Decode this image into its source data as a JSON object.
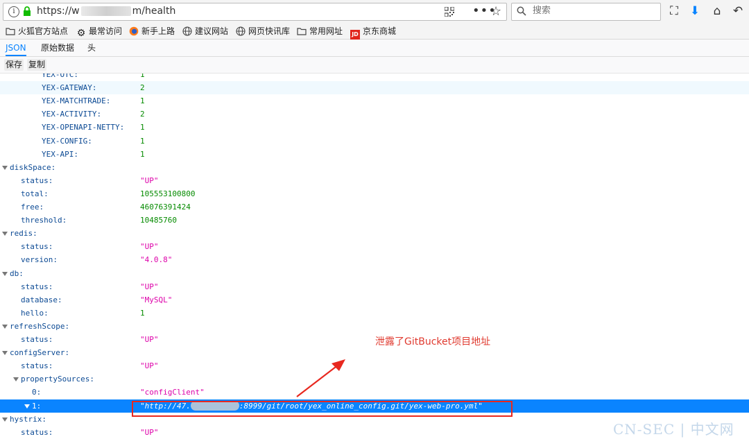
{
  "browser": {
    "url_prefix": "https://w",
    "url_suffix": "m/health",
    "search_placeholder": "搜索"
  },
  "bookmarks": [
    {
      "label": "火狐官方站点",
      "icon": "folder-icon"
    },
    {
      "label": "最常访问",
      "icon": "gear-icon"
    },
    {
      "label": "新手上路",
      "icon": "firefox-icon"
    },
    {
      "label": "建议网站",
      "icon": "globe-icon"
    },
    {
      "label": "网页快讯库",
      "icon": "globe-icon"
    },
    {
      "label": "常用网址",
      "icon": "folder-icon"
    },
    {
      "label": "京东商城",
      "icon": "jd-icon",
      "badge": "JD"
    }
  ],
  "viewer": {
    "tabs": [
      "JSON",
      "原始数据",
      "头"
    ],
    "buttons": [
      "保存",
      "复制"
    ]
  },
  "rows": [
    {
      "key": "YEX-OTC:",
      "val": "1",
      "type": "num",
      "indent": 60
    },
    {
      "key": "YEX-GATEWAY:",
      "val": "2",
      "type": "num",
      "indent": 60,
      "hl": true
    },
    {
      "key": "YEX-MATCHTRADE:",
      "val": "1",
      "type": "num",
      "indent": 60
    },
    {
      "key": "YEX-ACTIVITY:",
      "val": "2",
      "type": "num",
      "indent": 60
    },
    {
      "key": "YEX-OPENAPI-NETTY:",
      "val": "1",
      "type": "num",
      "indent": 60
    },
    {
      "key": "YEX-CONFIG:",
      "val": "1",
      "type": "num",
      "indent": 60
    },
    {
      "key": "YEX-API:",
      "val": "1",
      "type": "num",
      "indent": 60
    },
    {
      "key": "diskSpace:",
      "val": "",
      "type": "obj",
      "indent": 14
    },
    {
      "key": "status:",
      "val": "\"UP\"",
      "type": "str",
      "indent": 30
    },
    {
      "key": "total:",
      "val": "105553100800",
      "type": "num",
      "indent": 30
    },
    {
      "key": "free:",
      "val": "46076391424",
      "type": "num",
      "indent": 30
    },
    {
      "key": "threshold:",
      "val": "10485760",
      "type": "num",
      "indent": 30
    },
    {
      "key": "redis:",
      "val": "",
      "type": "obj",
      "indent": 14
    },
    {
      "key": "status:",
      "val": "\"UP\"",
      "type": "str",
      "indent": 30
    },
    {
      "key": "version:",
      "val": "\"4.0.8\"",
      "type": "str",
      "indent": 30
    },
    {
      "key": "db:",
      "val": "",
      "type": "obj",
      "indent": 14
    },
    {
      "key": "status:",
      "val": "\"UP\"",
      "type": "str",
      "indent": 30
    },
    {
      "key": "database:",
      "val": "\"MySQL\"",
      "type": "str",
      "indent": 30
    },
    {
      "key": "hello:",
      "val": "1",
      "type": "num",
      "indent": 30
    },
    {
      "key": "refreshScope:",
      "val": "",
      "type": "obj",
      "indent": 14
    },
    {
      "key": "status:",
      "val": "\"UP\"",
      "type": "str",
      "indent": 30
    },
    {
      "key": "configServer:",
      "val": "",
      "type": "obj",
      "indent": 14
    },
    {
      "key": "status:",
      "val": "\"UP\"",
      "type": "str",
      "indent": 30
    },
    {
      "key": "propertySources:",
      "val": "",
      "type": "obj",
      "indent": 30
    },
    {
      "key": "0:",
      "val": "\"configClient\"",
      "type": "str",
      "indent": 46
    },
    {
      "key": "1:",
      "val": "",
      "type": "obj",
      "indent": 46,
      "sel": true
    },
    {
      "key": "hystrix:",
      "val": "",
      "type": "obj",
      "indent": 14
    },
    {
      "key": "status:",
      "val": "\"UP\"",
      "type": "str",
      "indent": 30
    }
  ],
  "selected_value": {
    "prefix": "\"http://47.",
    "suffix": ":8999/git/root/yex_online_config.git/yex-web-pro.yml\""
  },
  "annotation": "泄露了GitBucket项目地址",
  "watermark": "CN-SEC | 中文网"
}
